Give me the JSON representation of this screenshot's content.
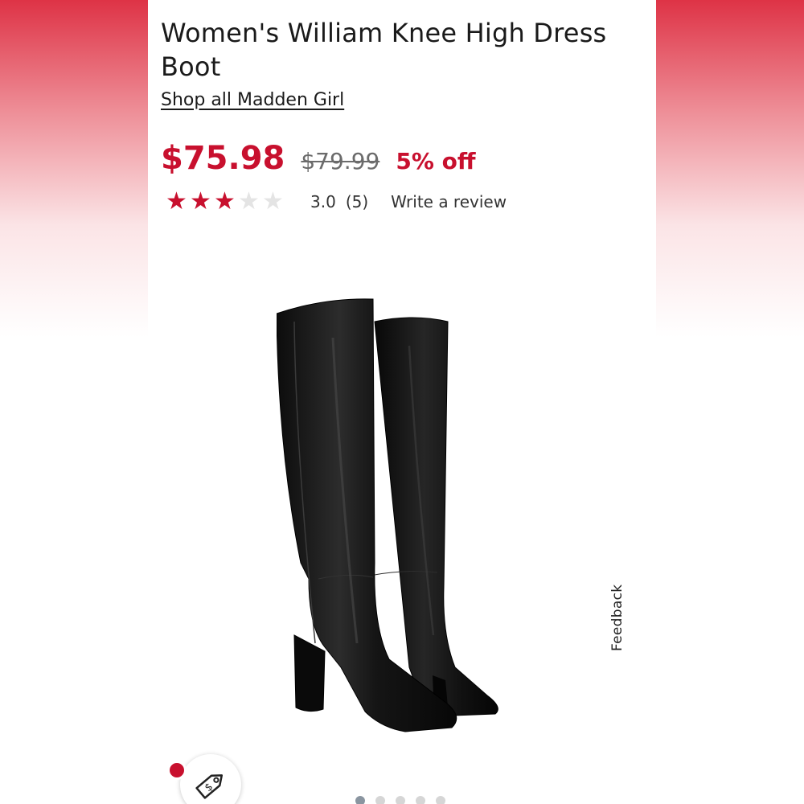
{
  "product": {
    "title": "Women's William Knee High Dress Boot",
    "brand_link": "Shop all Madden Girl",
    "price_current": "$75.98",
    "price_original": "$79.99",
    "discount": "5% off",
    "rating_value": "3.0",
    "review_count": "(5)",
    "rating_stars": 3,
    "rating_max": 5,
    "write_review": "Write a review"
  },
  "feedback_label": "Feedback",
  "icons": {
    "price_tag": "price-tag-icon",
    "notification_dot": "notification-dot"
  },
  "carousel": {
    "count": 5,
    "active_index": 0
  },
  "colors": {
    "accent": "#c8102e",
    "star_empty": "#e4e4e4",
    "header_gradient": "#de3346"
  }
}
